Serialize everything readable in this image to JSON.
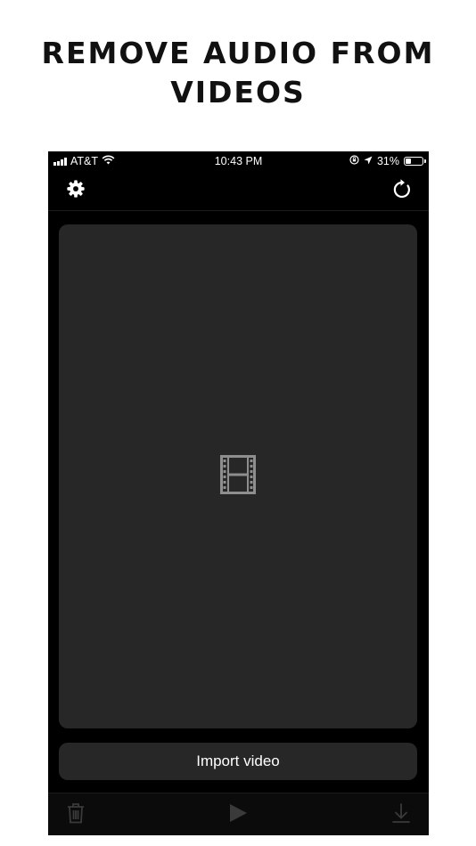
{
  "headline": {
    "line1": "REMOVE AUDIO FROM",
    "line2": "VIDEOS"
  },
  "status_bar": {
    "carrier": "AT&T",
    "time": "10:43 PM",
    "battery_percent": "31%",
    "battery_level": 0.31
  },
  "nav": {
    "left_icon": "gear-icon",
    "right_icon": "refresh-icon"
  },
  "preview": {
    "placeholder_icon": "film-icon"
  },
  "import_button": {
    "label": "Import video"
  },
  "toolbar": {
    "icons": [
      "trash-icon",
      "play-icon",
      "download-icon"
    ]
  },
  "colors": {
    "background": "#000000",
    "panel": "#272727",
    "disabled_icon": "#3a3a3a",
    "text": "#ffffff"
  }
}
